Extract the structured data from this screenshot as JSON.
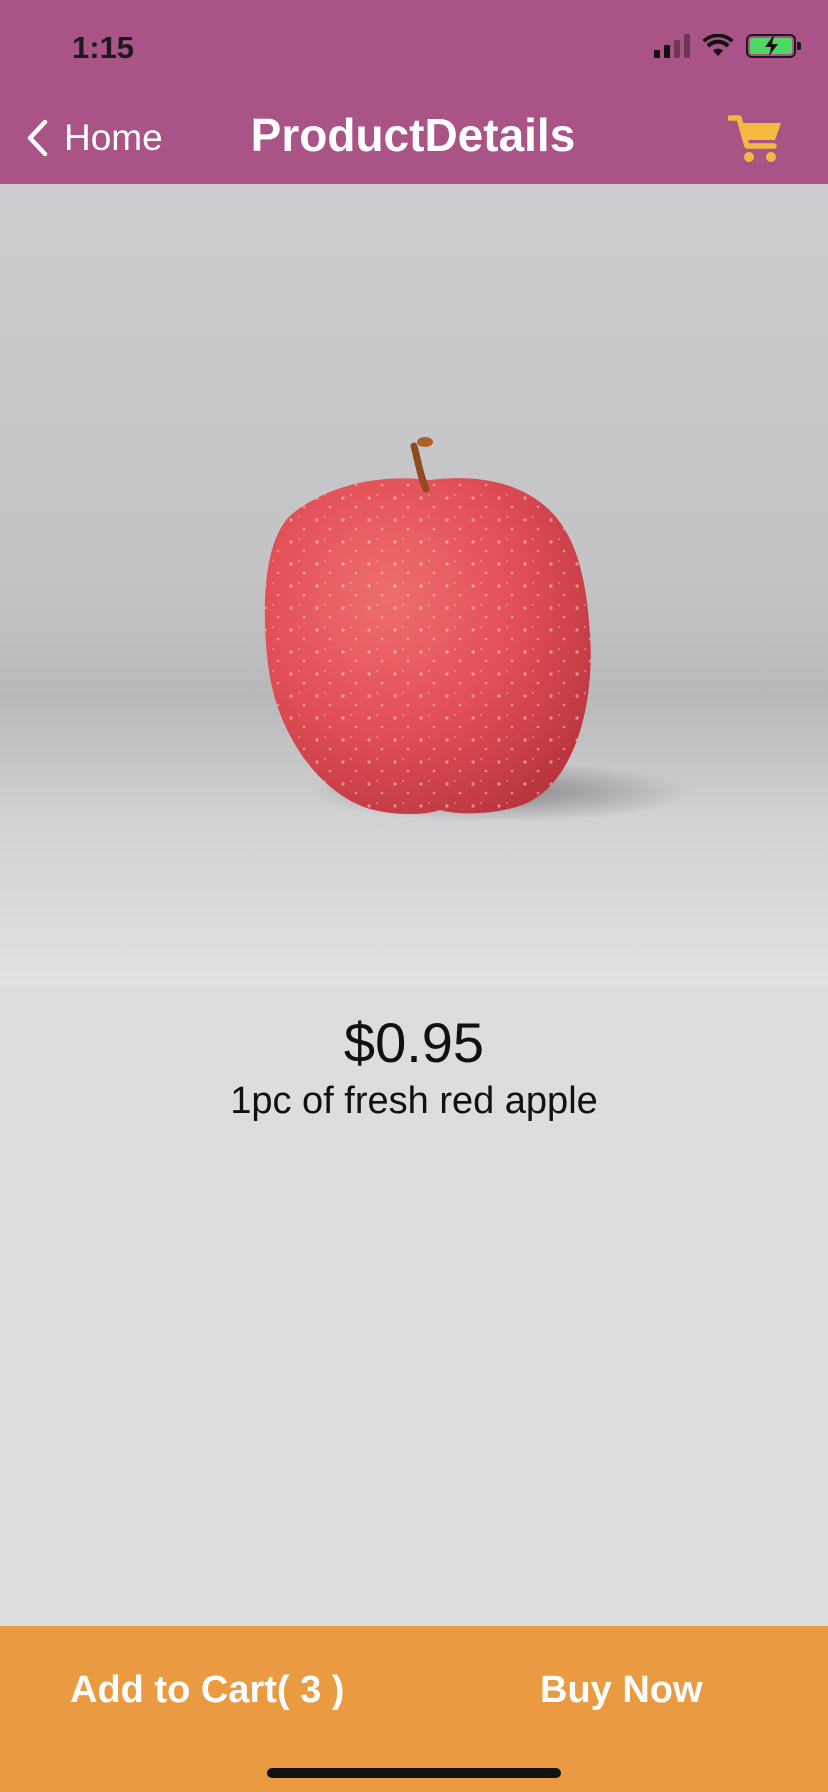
{
  "status_bar": {
    "time": "1:15",
    "icons": [
      "signal-icon",
      "wifi-icon",
      "battery-charging-icon"
    ]
  },
  "nav": {
    "back_label": "Home",
    "back_icon": "chevron-left-icon",
    "title": "ProductDetails",
    "cart_icon": "shopping-cart-icon"
  },
  "product": {
    "image": "red-apple-photo",
    "price": "$0.95",
    "description": "1pc of fresh red apple"
  },
  "actions": {
    "add_to_cart_label": "Add to Cart( 3 )",
    "buy_now_label": "Buy Now"
  },
  "colors": {
    "header": "#a95387",
    "accent_cart": "#f5b940",
    "bottom_bar": "#ea9a40",
    "background": "#dddddd"
  }
}
